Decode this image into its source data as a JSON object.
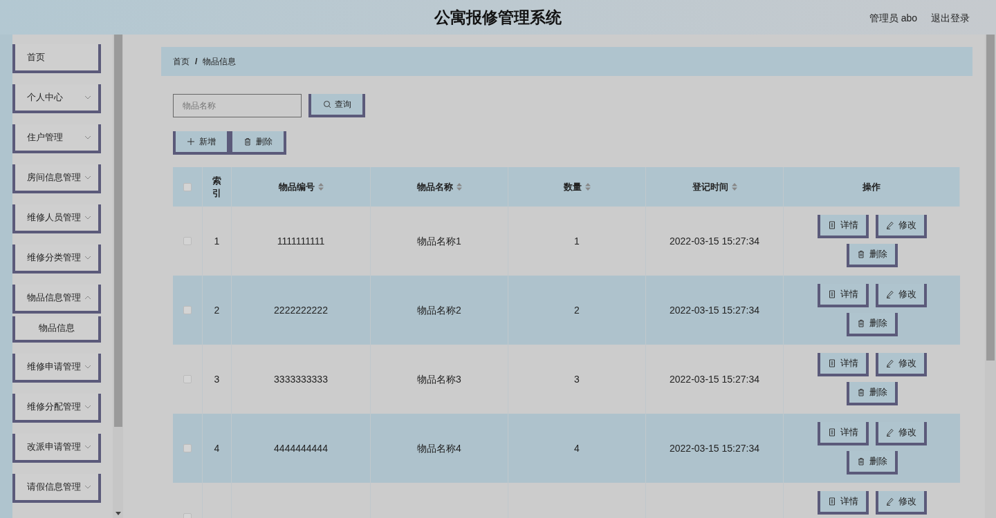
{
  "header": {
    "title": "公寓报修管理系统",
    "user": "管理员 abo",
    "logout": "退出登录"
  },
  "sidebar": {
    "items": [
      {
        "label": "首页",
        "kind": "link"
      },
      {
        "label": "个人中心",
        "kind": "menu",
        "expanded": false
      },
      {
        "label": "住户管理",
        "kind": "menu",
        "expanded": false
      },
      {
        "label": "房间信息管理",
        "kind": "menu",
        "expanded": false
      },
      {
        "label": "维修人员管理",
        "kind": "menu",
        "expanded": false
      },
      {
        "label": "维修分类管理",
        "kind": "menu",
        "expanded": false
      },
      {
        "label": "物品信息管理",
        "kind": "menu",
        "expanded": true,
        "children": [
          {
            "label": "物品信息"
          }
        ]
      },
      {
        "label": "维修申请管理",
        "kind": "menu",
        "expanded": false
      },
      {
        "label": "维修分配管理",
        "kind": "menu",
        "expanded": false
      },
      {
        "label": "改派申请管理",
        "kind": "menu",
        "expanded": false
      },
      {
        "label": "请假信息管理",
        "kind": "menu",
        "expanded": false
      }
    ]
  },
  "breadcrumb": [
    "首页",
    "物品信息"
  ],
  "breadcrumb_separator": "/",
  "search": {
    "placeholder": "物品名称",
    "button": "查询"
  },
  "toolbar": [
    {
      "kind": "add",
      "label": "新增"
    },
    {
      "kind": "delete",
      "label": "删除"
    }
  ],
  "table": {
    "select_all": {
      "checked": false
    },
    "columns": [
      {
        "label": "索引",
        "sortable": false
      },
      {
        "label": "物品编号",
        "sortable": true
      },
      {
        "label": "物品名称",
        "sortable": true
      },
      {
        "label": "数量",
        "sortable": true
      },
      {
        "label": "登记时间",
        "sortable": true
      },
      {
        "label": "操作",
        "sortable": false
      }
    ],
    "rows": [
      {
        "checked": false,
        "cells": [
          "1",
          "1111111111",
          "物品名称1",
          "1",
          "2022-03-15 15:27:34"
        ],
        "actions": [
          {
            "kind": "detail",
            "label": "详情"
          },
          {
            "kind": "edit",
            "label": "修改"
          },
          {
            "kind": "delete",
            "label": "删除"
          }
        ]
      },
      {
        "checked": false,
        "cells": [
          "2",
          "2222222222",
          "物品名称2",
          "2",
          "2022-03-15 15:27:34"
        ],
        "actions": [
          {
            "kind": "detail",
            "label": "详情"
          },
          {
            "kind": "edit",
            "label": "修改"
          },
          {
            "kind": "delete",
            "label": "删除"
          }
        ]
      },
      {
        "checked": false,
        "cells": [
          "3",
          "3333333333",
          "物品名称3",
          "3",
          "2022-03-15 15:27:34"
        ],
        "actions": [
          {
            "kind": "detail",
            "label": "详情"
          },
          {
            "kind": "edit",
            "label": "修改"
          },
          {
            "kind": "delete",
            "label": "删除"
          }
        ]
      },
      {
        "checked": false,
        "cells": [
          "4",
          "4444444444",
          "物品名称4",
          "4",
          "2022-03-15 15:27:34"
        ],
        "actions": [
          {
            "kind": "detail",
            "label": "详情"
          },
          {
            "kind": "edit",
            "label": "修改"
          },
          {
            "kind": "delete",
            "label": "删除"
          }
        ]
      },
      {
        "checked": false,
        "cells": [],
        "actions": [
          {
            "kind": "detail",
            "label": "详情"
          },
          {
            "kind": "edit",
            "label": "修改"
          }
        ]
      }
    ]
  }
}
